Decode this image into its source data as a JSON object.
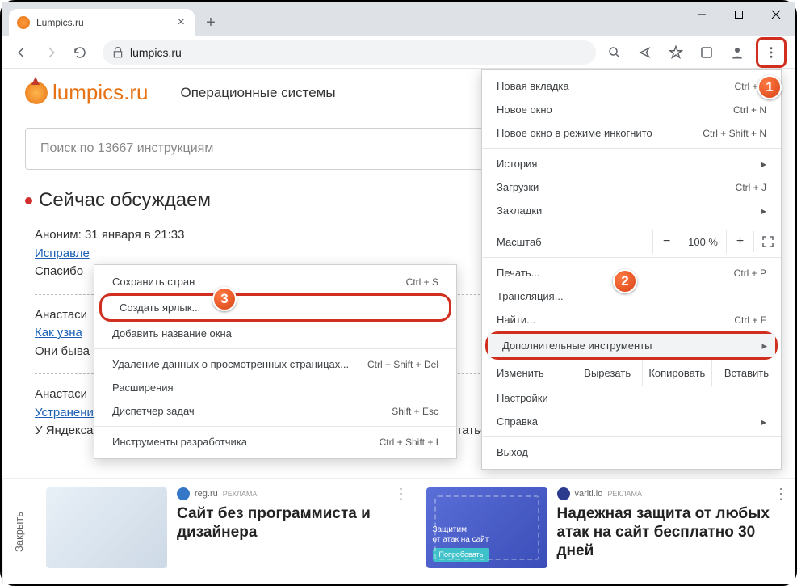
{
  "titlebar": {
    "tab_title": "Lumpics.ru"
  },
  "addrbar": {
    "url": "lumpics.ru"
  },
  "site": {
    "logo": "lumpics.ru",
    "nav1": "Операционные системы",
    "search_placeholder": "Поиск по 13667 инструкциям",
    "heading": "Сейчас обсуждаем"
  },
  "comments": [
    {
      "meta": "Аноним: 31 января в 21:33",
      "link": "Исправле",
      "body": "Спасибо"
    },
    {
      "meta": "Анастаси",
      "link": "Как узна",
      "body": "Они быва"
    },
    {
      "meta": "Анастаси",
      "link": "Устранение проблем с подключением Яндекс.Станции к интернету",
      "body": "У Яндекса работает служба поддержки покупателей - обратитесь туда. В статье п"
    }
  ],
  "mainmenu": {
    "new_tab": "Новая вкладка",
    "new_tab_sc": "Ctrl + T",
    "new_win": "Новое окно",
    "new_win_sc": "Ctrl + N",
    "incognito": "Новое окно в режиме инкогнито",
    "incognito_sc": "Ctrl + Shift + N",
    "history": "История",
    "downloads": "Загрузки",
    "downloads_sc": "Ctrl + J",
    "bookmarks": "Закладки",
    "zoom": "Масштаб",
    "zoom_val": "100 %",
    "print": "Печать...",
    "print_sc": "Ctrl + P",
    "cast": "Трансляция...",
    "find": "Найти...",
    "find_sc": "Ctrl + F",
    "more_tools": "Дополнительные инструменты",
    "edit": "Изменить",
    "cut": "Вырезать",
    "copy": "Копировать",
    "paste": "Вставить",
    "settings": "Настройки",
    "help": "Справка",
    "exit": "Выход"
  },
  "submenu": {
    "save_page": "Сохранить стран",
    "save_page_sc": "Ctrl + S",
    "create_shortcut": "Создать ярлык...",
    "name_window": "Добавить название окна",
    "clear_data": "Удаление данных о просмотренных страницах...",
    "clear_data_sc": "Ctrl + Shift + Del",
    "extensions": "Расширения",
    "task_mgr": "Диспетчер задач",
    "task_mgr_sc": "Shift + Esc",
    "dev_tools": "Инструменты разработчика",
    "dev_tools_sc": "Ctrl + Shift + I"
  },
  "ads": {
    "close": "Закрыть",
    "card1": {
      "site": "reg.ru",
      "tag": "РЕКЛАМА",
      "title": "Сайт без программиста и дизайнера"
    },
    "card2": {
      "site": "variti.io",
      "tag": "РЕКЛАМА",
      "title": "Надежная защита от любых атак на сайт бесплатно 30 дней",
      "overlay1": "Защитим",
      "overlay2": "от атак на сайт",
      "btn": "Попробовать"
    }
  }
}
